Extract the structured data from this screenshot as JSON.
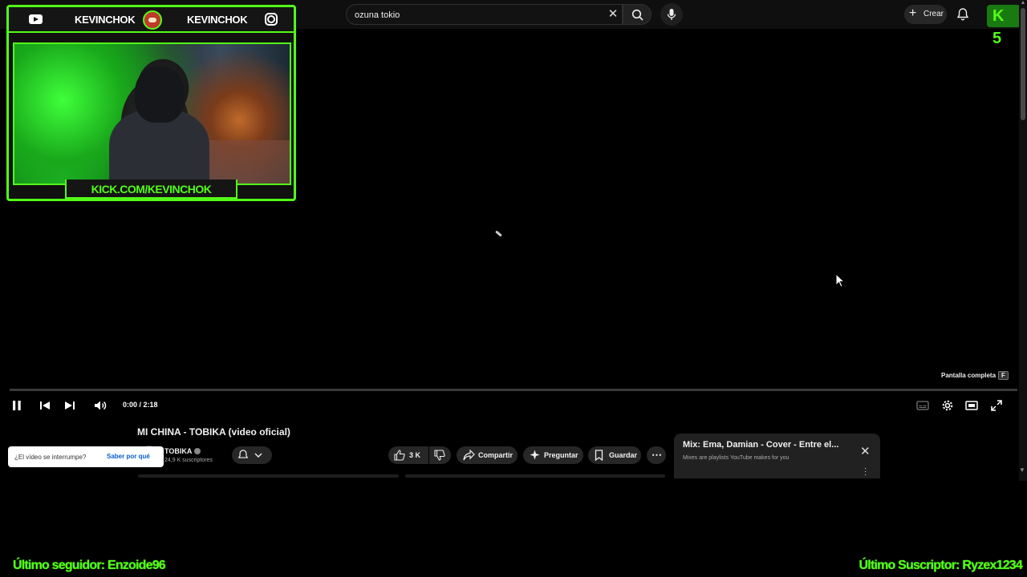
{
  "search": {
    "value": "ozuna tokio"
  },
  "header": {
    "create_label": "Crear",
    "kick_logo": "K 5"
  },
  "stream_overlay": {
    "left_name": "KEVINCHOK",
    "right_name": "KEVINCHOK",
    "url": "KICK.COM/KEVINCHOK",
    "accent_color": "#53fc18"
  },
  "player": {
    "fullscreen_tip": "Pantalla completa",
    "fullscreen_key": "F",
    "time": "0:00 / 2:18",
    "progress": 0
  },
  "video": {
    "title": "MI CHINA - TOBIKA (video oficial)",
    "channel": "TOBIKA",
    "subscribers": "24,9 K suscriptores",
    "likes": "3 K",
    "share_label": "Compartir",
    "ask_label": "Preguntar",
    "save_label": "Guardar"
  },
  "interrupt_prompt": {
    "question": "¿El vídeo se interrumpe?",
    "link": "Saber por qué"
  },
  "mix": {
    "title": "Mix: Ema, Damian - Cover - Entre el...",
    "subtitle": "Mixes are playlists YouTube makes for you"
  },
  "stream_footer": {
    "last_follower": "Último seguidor: Enzoide96",
    "last_subscriber": "Último Suscriptor: Ryzex1234"
  },
  "icons": [
    "hamburger-icon",
    "search-icon",
    "clear-icon",
    "mic-icon",
    "plus-icon",
    "bell-icon",
    "play-pause-icon",
    "previous-icon",
    "next-icon",
    "volume-icon",
    "subtitles-icon",
    "settings-icon",
    "miniplayer-icon",
    "fullscreen-icon",
    "like-icon",
    "dislike-icon",
    "share-icon",
    "sparkle-icon",
    "bookmark-icon",
    "more-icon",
    "close-icon",
    "kebab-icon"
  ]
}
